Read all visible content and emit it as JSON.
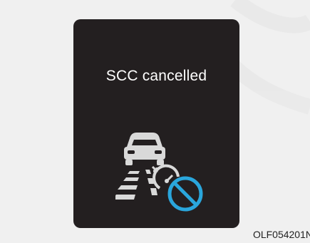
{
  "display": {
    "message": "SCC cancelled"
  },
  "icons": {
    "status_icon": "scc-cancelled-icon",
    "cancel_symbol": "prohibited-icon"
  },
  "colors": {
    "panel_background": "#231f20",
    "message_text": "#ffffff",
    "icon_gray": "#d9d9d9",
    "cancel_blue": "#2aa6dc",
    "page_background": "#f0f0f0"
  },
  "figure_code": "OLF054201N"
}
